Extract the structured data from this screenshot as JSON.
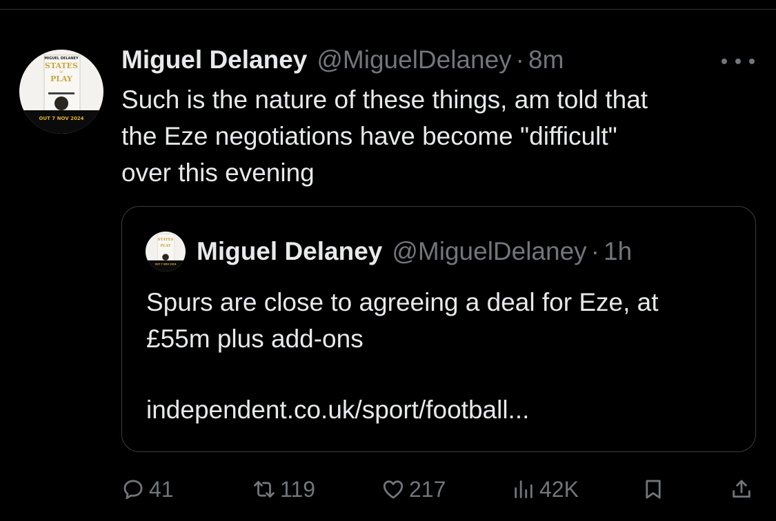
{
  "tweet": {
    "author": {
      "display_name": "Miguel Delaney",
      "handle": "@MiguelDelaney",
      "separator": "·",
      "time": "8m"
    },
    "text_lines": [
      "Such is the nature of these things, am told that",
      "the Eze negotiations have become \"difficult\"",
      "over this evening"
    ],
    "avatar": {
      "line1": "MIGUEL DELANEY",
      "line2": "STATES",
      "line3": "OF",
      "line4": "PLAY",
      "line5": "OUT 7 NOV 2024"
    }
  },
  "quoted_tweet": {
    "author": {
      "display_name": "Miguel Delaney",
      "handle": "@MiguelDelaney",
      "separator": "·",
      "time": "1h"
    },
    "text_lines": [
      "Spurs are close to agreeing a deal for Eze, at",
      "£55m plus add-ons"
    ],
    "link": "independent.co.uk/sport/football..."
  },
  "actions": {
    "reply": {
      "icon": "reply-icon",
      "count": "41"
    },
    "retweet": {
      "icon": "retweet-icon",
      "count": "119"
    },
    "like": {
      "icon": "heart-icon",
      "count": "217"
    },
    "views": {
      "icon": "views-icon",
      "count": "42K"
    },
    "bookmark": {
      "icon": "bookmark-icon"
    },
    "share": {
      "icon": "share-icon"
    }
  },
  "colors": {
    "background": "#000000",
    "text": "#e7e9ea",
    "secondary": "#71767b",
    "border": "#3a3e42",
    "avatar_gold": "#c9a53e"
  }
}
